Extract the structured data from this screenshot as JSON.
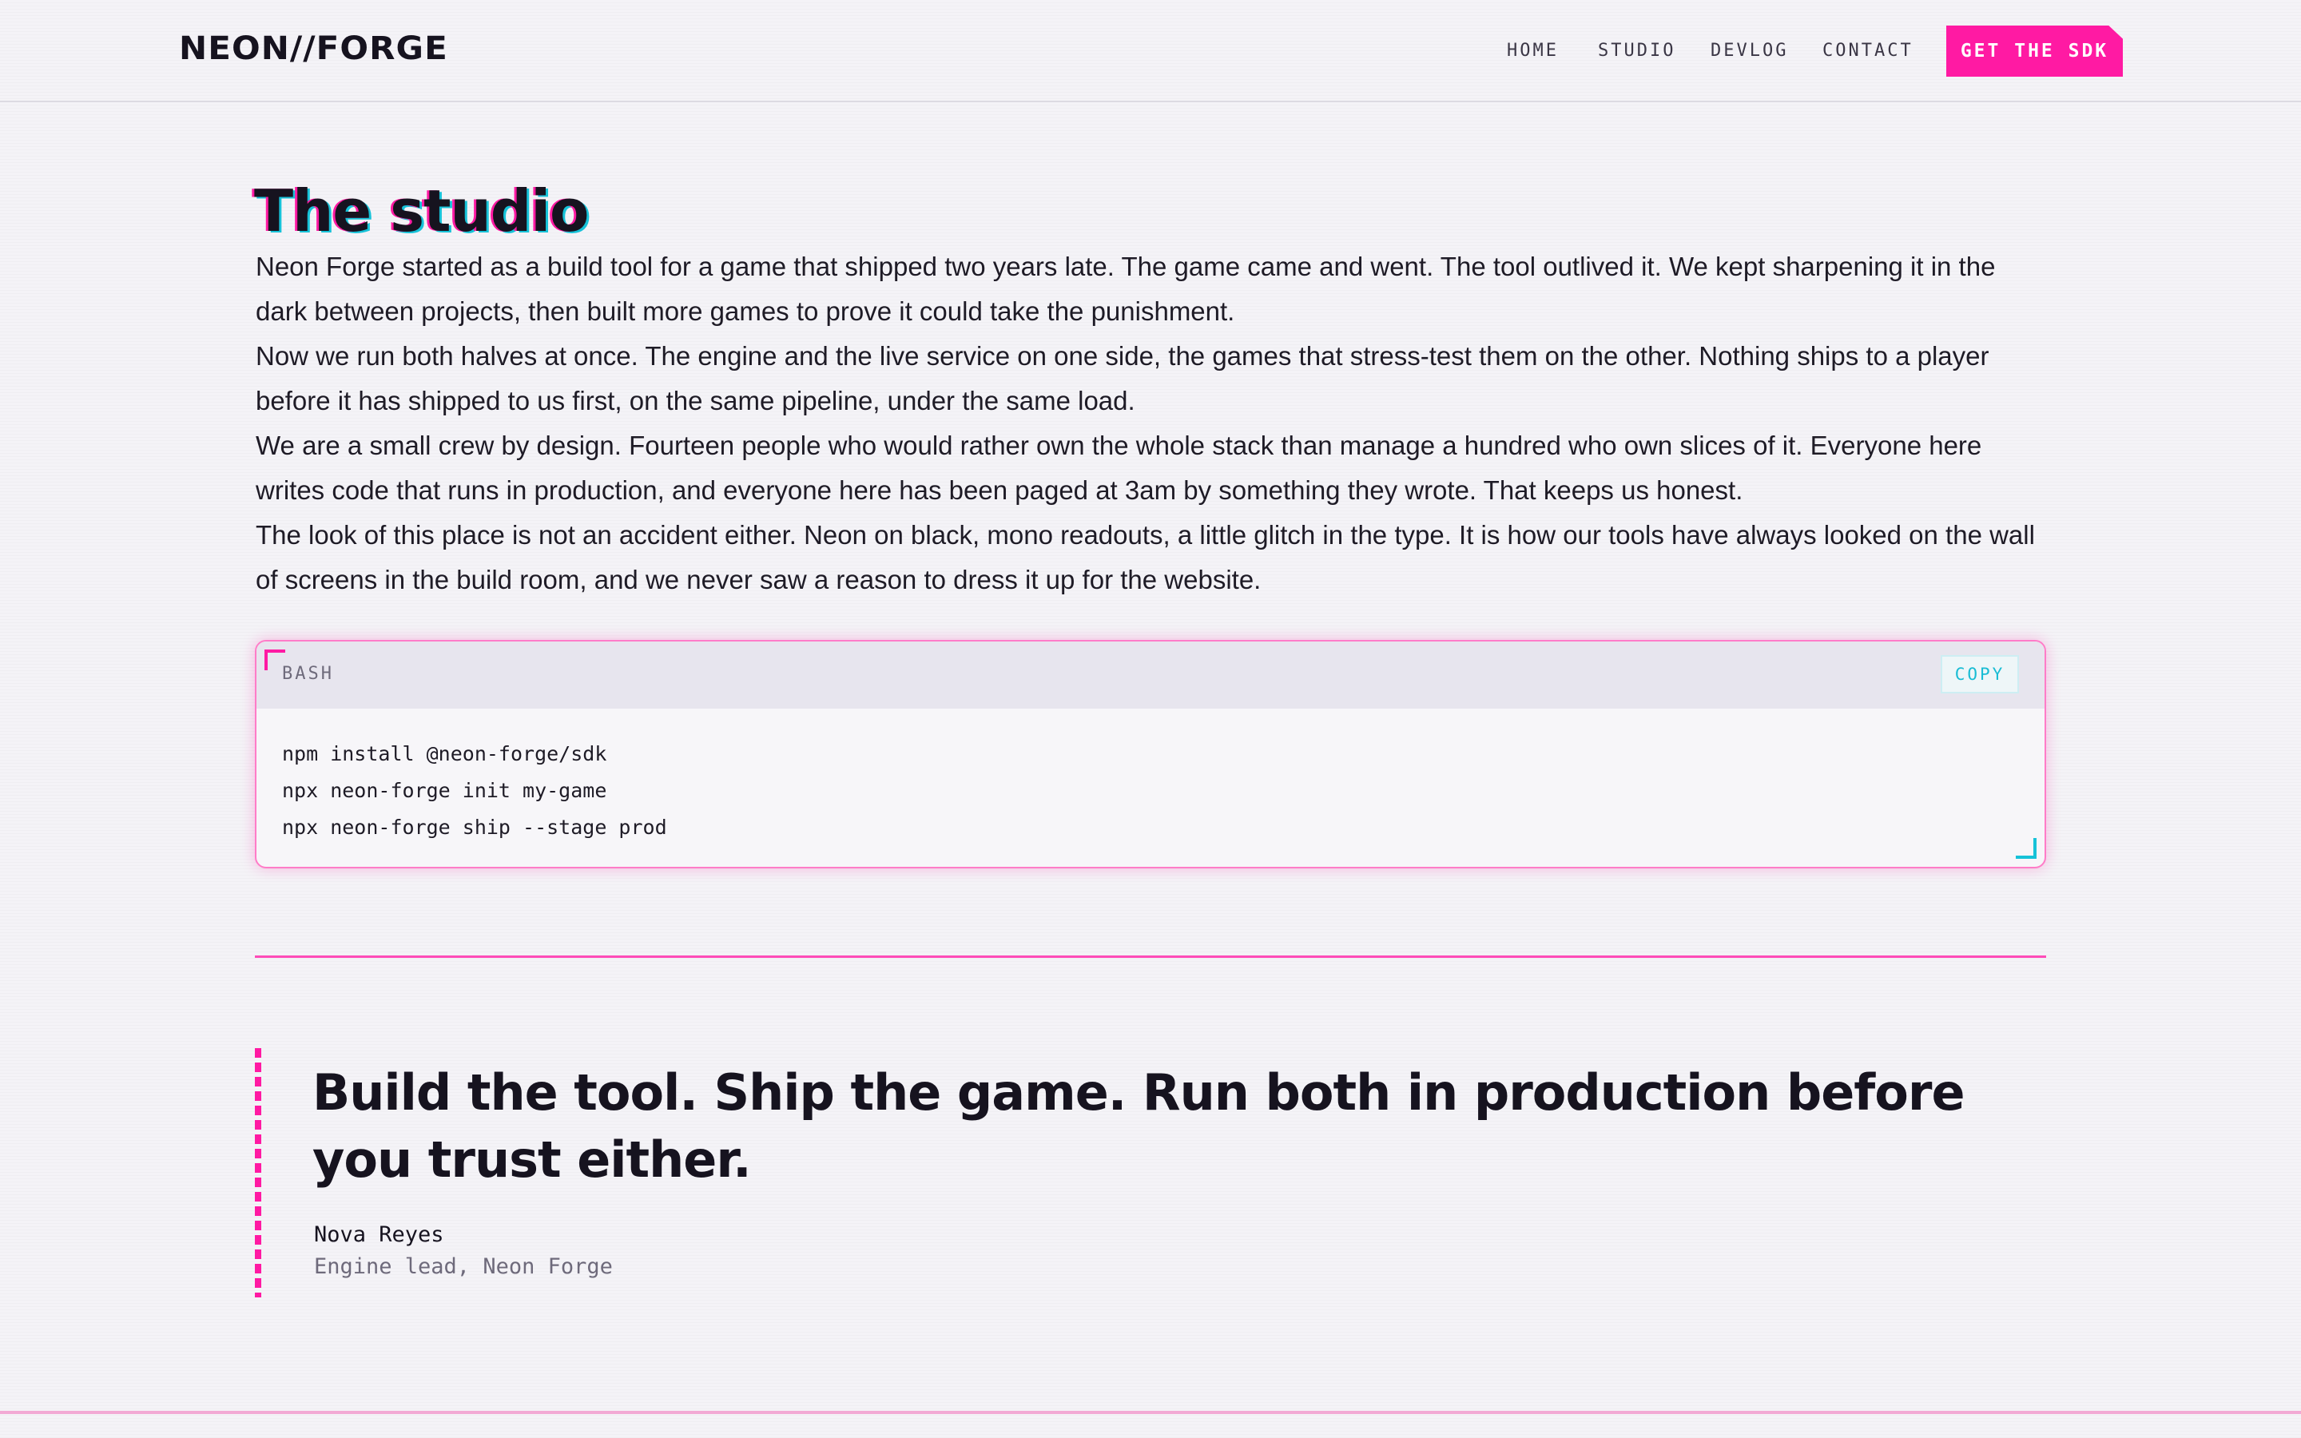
{
  "header": {
    "logo": "NEON//FORGE",
    "nav": {
      "home": "HOME",
      "studio": "STUDIO",
      "devlog": "DEVLOG",
      "contact": "CONTACT"
    },
    "cta_label": "GET THE SDK"
  },
  "studio": {
    "title": "The studio",
    "paragraphs": [
      "Neon Forge started as a build tool for a game that shipped two years late. The game came and went. The tool outlived it. We kept sharpening it in the dark between projects, then built more games to prove it could take the punishment.",
      "Now we run both halves at once. The engine and the live service on one side, the games that stress-test them on the other. Nothing ships to a player before it has shipped to us first, on the same pipeline, under the same load.",
      "We are a small crew by design. Fourteen people who would rather own the whole stack than manage a hundred who own slices of it. Everyone here writes code that runs in production, and everyone here has been paged at 3am by something they wrote. That keeps us honest.",
      "The look of this place is not an accident either. Neon on black, mono readouts, a little glitch in the type. It is how our tools have always looked on the wall of screens in the build room, and we never saw a reason to dress it up for the website."
    ]
  },
  "code_block": {
    "language": "BASH",
    "copy_label": "COPY",
    "lines": [
      "npm install @neon-forge/sdk",
      "npx neon-forge init my-game",
      "npx neon-forge ship --stage prod"
    ]
  },
  "quote": {
    "text": "Build the tool. Ship the game. Run both in production before you trust either.",
    "author": "Nova Reyes",
    "role": "Engine lead, Neon Forge"
  },
  "colors": {
    "accent_pink": "#ff1aa3",
    "accent_cyan": "#16c2d8",
    "ink": "#16131f",
    "background": "#f4f3f7"
  }
}
